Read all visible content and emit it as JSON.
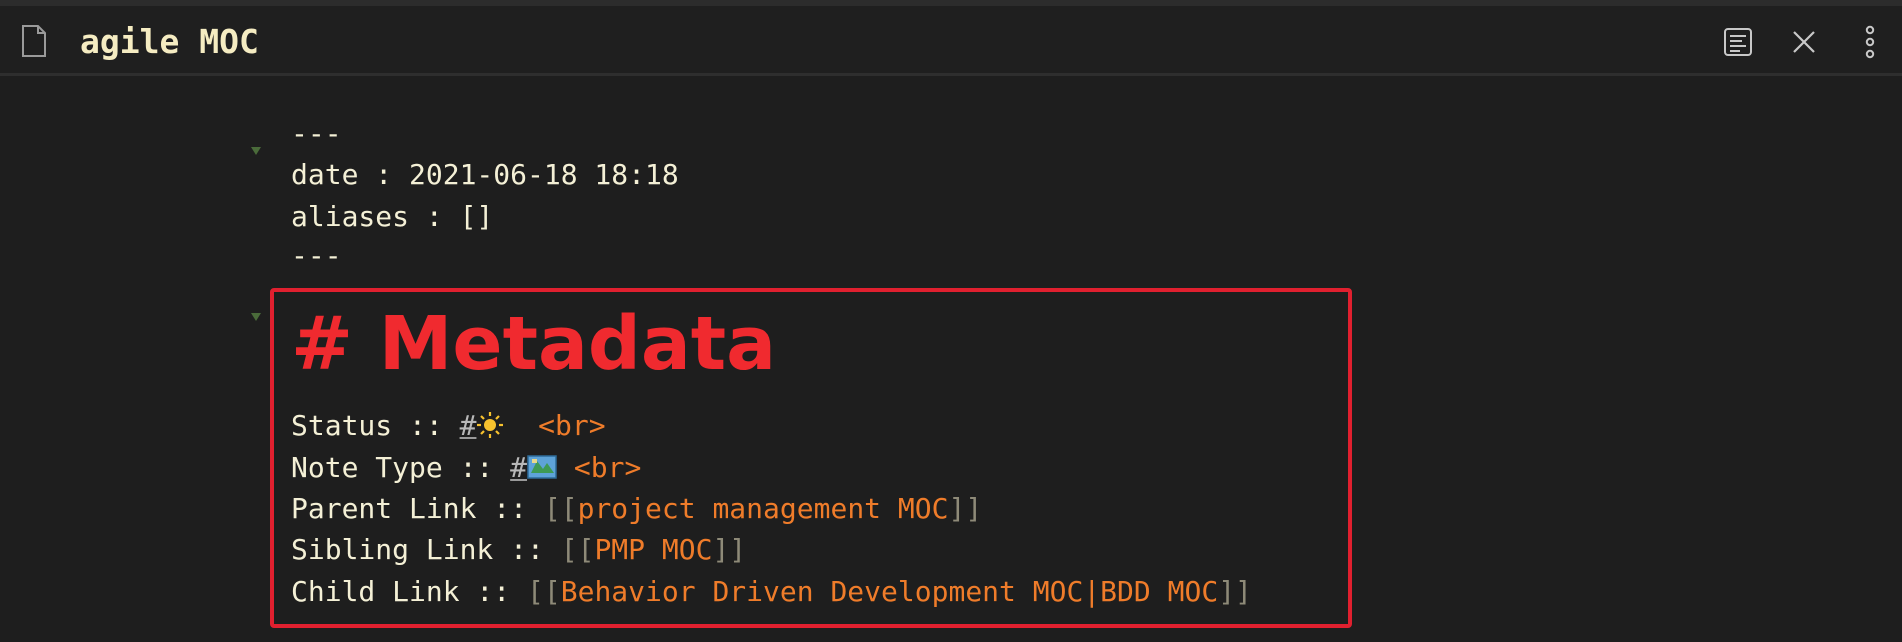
{
  "header": {
    "title": "agile MOC",
    "file_icon": "file-icon",
    "reading_view_icon": "reading-view-icon",
    "close_icon": "close-icon",
    "more_icon": "more-options-icon"
  },
  "frontmatter": {
    "open_delim": "---",
    "date_line": "date : 2021-06-18 18:18",
    "aliases_line": "aliases : []",
    "close_delim": "---"
  },
  "metadata": {
    "heading": "# Metadata",
    "status_label": "Status :: ",
    "status_tag": "#",
    "status_emoji": "sun-emoji",
    "status_br": "<br>",
    "note_type_label": "Note Type :: ",
    "note_type_tag": "#",
    "note_type_emoji": "map-emoji",
    "note_type_br": "<br>",
    "parent_label": "Parent Link :: ",
    "parent_open": "[[",
    "parent_link": "project management MOC",
    "parent_close": "]]",
    "sibling_label": "Sibling Link :: ",
    "sibling_open": "[[",
    "sibling_link": "PMP MOC",
    "sibling_close": "]]",
    "child_label": "Child Link :: ",
    "child_open": "[[",
    "child_link": "Behavior Driven Development MOC|BDD MOC",
    "child_close": "]]"
  },
  "colors": {
    "background": "#1e1e1e",
    "text": "#f4f0d6",
    "heading": "#f02a2f",
    "link": "#ef7c2a",
    "highlight_border": "#e0202f"
  }
}
